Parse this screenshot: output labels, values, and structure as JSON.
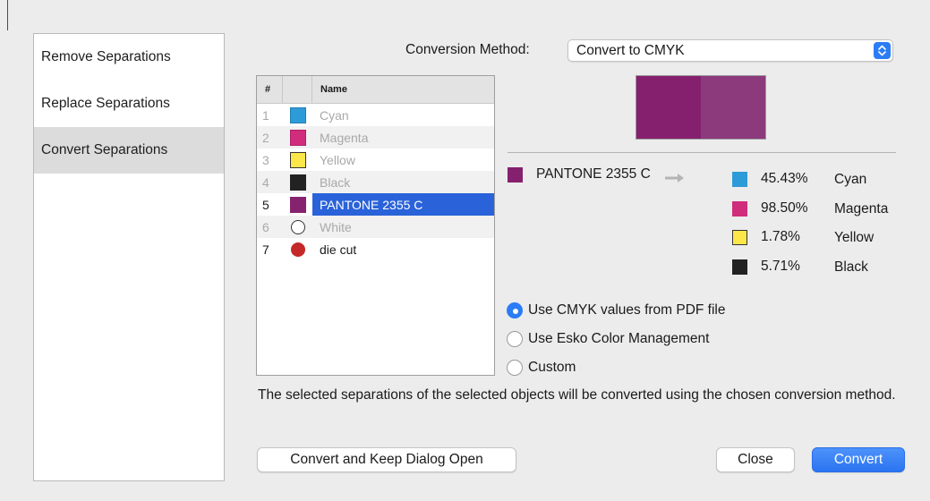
{
  "sidebar": {
    "items": [
      {
        "label": "Remove Separations",
        "selected": false
      },
      {
        "label": "Replace Separations",
        "selected": false
      },
      {
        "label": "Convert Separations",
        "selected": true
      }
    ]
  },
  "conversion": {
    "label": "Conversion Method:",
    "selected_value": "Convert to CMYK",
    "arrow_icon": "up-down-chevron-icon"
  },
  "separations": {
    "headers": {
      "num": "#",
      "swatch": "",
      "name": "Name"
    },
    "rows": [
      {
        "num": "1",
        "name": "Cyan",
        "color": "#2d9bd7",
        "shape": "square",
        "enabled": false
      },
      {
        "num": "2",
        "name": "Magenta",
        "color": "#d02d7c",
        "shape": "square",
        "enabled": false
      },
      {
        "num": "3",
        "name": "Yellow",
        "color": "#fbe74a",
        "shape": "square",
        "enabled": false
      },
      {
        "num": "4",
        "name": "Black",
        "color": "#222222",
        "shape": "square",
        "enabled": false
      },
      {
        "num": "5",
        "name": "PANTONE 2355 C",
        "color": "#87226f",
        "shape": "square",
        "enabled": true,
        "selected": true
      },
      {
        "num": "6",
        "name": "White",
        "color": "#ffffff",
        "shape": "circle",
        "enabled": false
      },
      {
        "num": "7",
        "name": "die cut",
        "color": "#c42828",
        "shape": "circle",
        "enabled": true
      }
    ]
  },
  "preview": {
    "original": "#85206f",
    "converted": "#8c3a7c"
  },
  "spot": {
    "name": "PANTONE 2355 C",
    "color": "#85206f",
    "arrow_icon": "right-arrow-icon"
  },
  "cmyk": [
    {
      "percent": "45.43%",
      "name": "Cyan",
      "color": "#2d9bd7"
    },
    {
      "percent": "98.50%",
      "name": "Magenta",
      "color": "#d02d7c"
    },
    {
      "percent": "1.78%",
      "name": "Yellow",
      "color": "#fbe74a"
    },
    {
      "percent": "5.71%",
      "name": "Black",
      "color": "#222222"
    }
  ],
  "options": [
    {
      "label": "Use CMYK values from PDF file",
      "checked": true
    },
    {
      "label": "Use Esko Color Management",
      "checked": false
    },
    {
      "label": "Custom",
      "checked": false
    }
  ],
  "description": "The selected separations of the selected objects will be converted using the chosen conversion method.",
  "buttons": {
    "keep_open": "Convert and Keep Dialog Open",
    "close": "Close",
    "convert": "Convert"
  }
}
